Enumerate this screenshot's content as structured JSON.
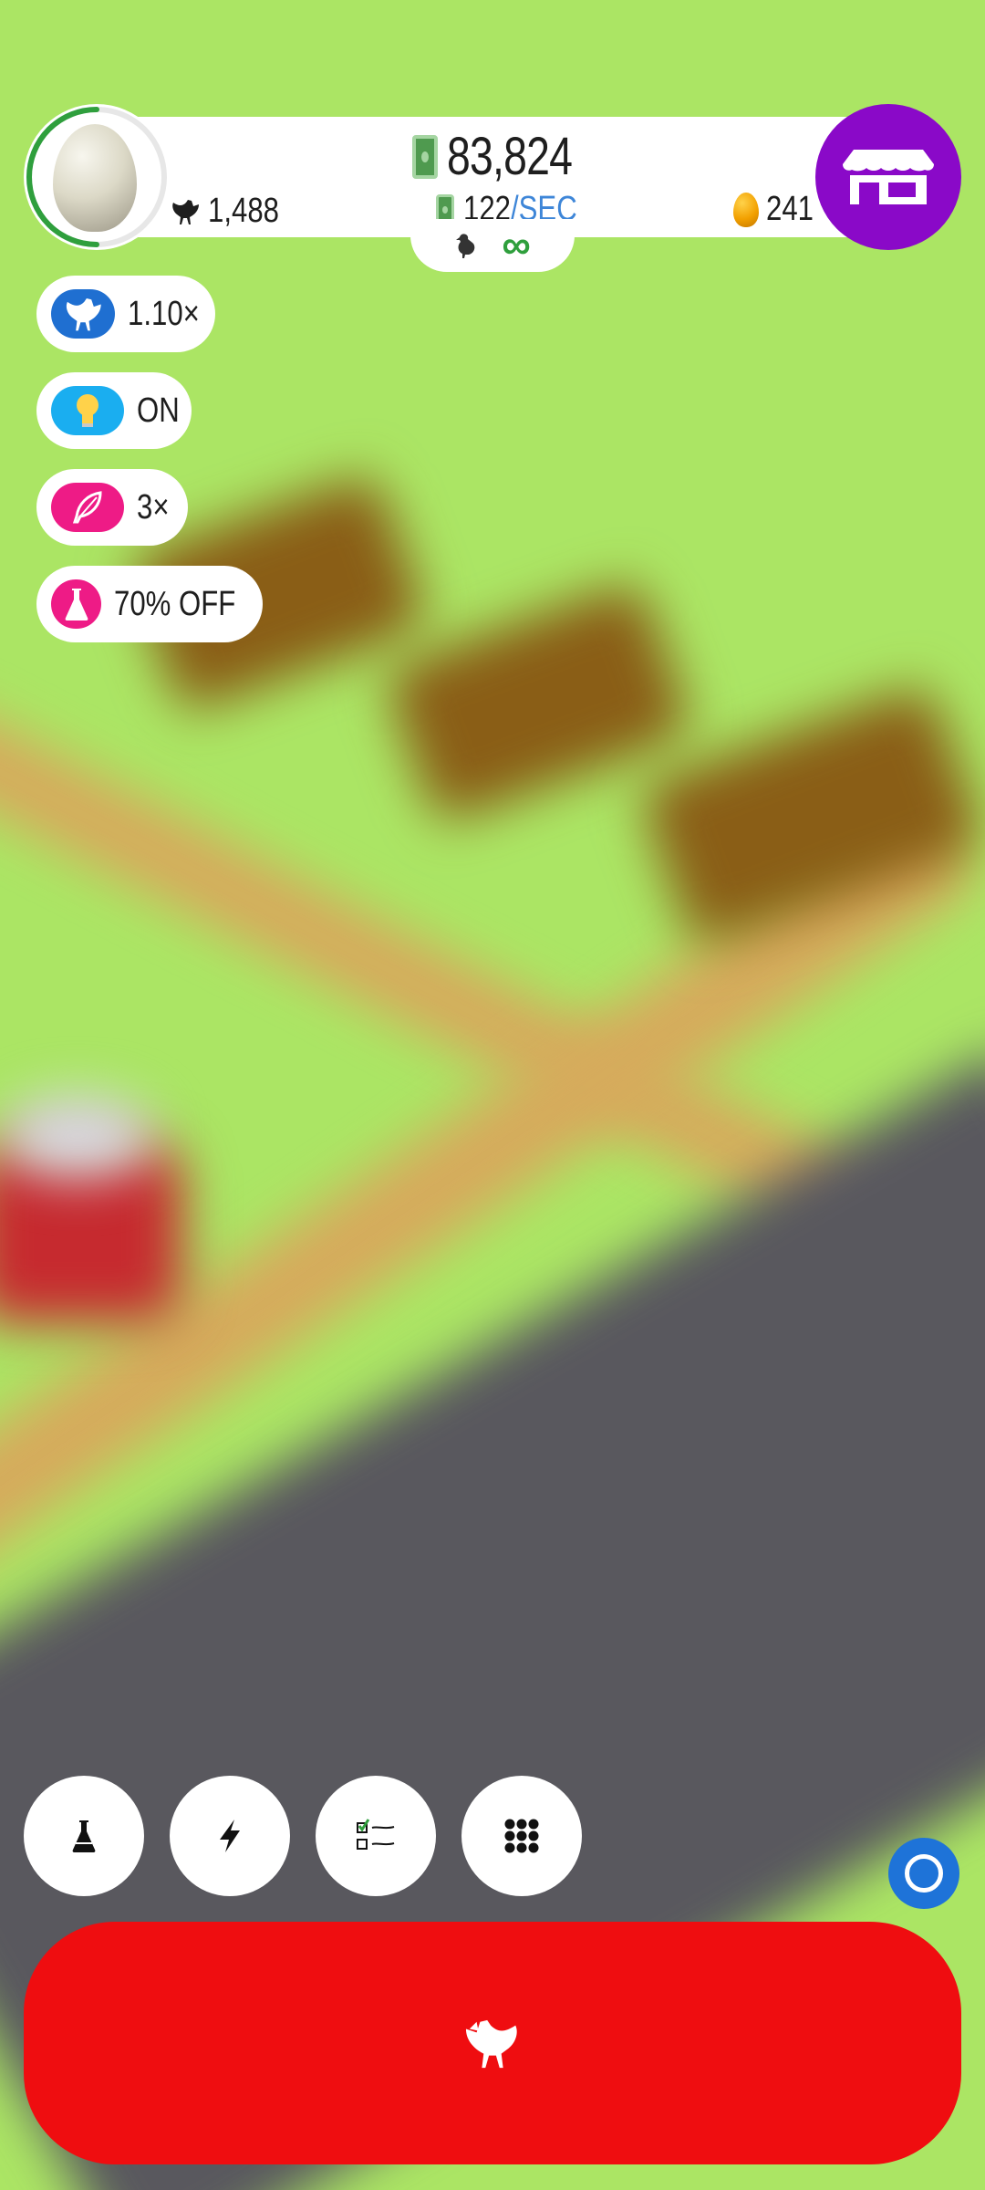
{
  "hud": {
    "money": "83,824",
    "chicken_count": "1,488",
    "rate_value": "122",
    "rate_unit": "/SEC",
    "golden_eggs": "241",
    "habitat_capacity": "∞"
  },
  "boosts": [
    {
      "icon": "chicken-icon",
      "label": "1.10×",
      "color": "#1f6fd1"
    },
    {
      "icon": "lightbulb-icon",
      "label": "ON",
      "color": "#1aaef0"
    },
    {
      "icon": "feather-icon",
      "label": "3×",
      "color": "#ee1b86"
    },
    {
      "icon": "flask-icon",
      "label": "70% OFF",
      "color": "#ee1b86"
    }
  ],
  "toolbar": [
    {
      "icon": "flask-icon",
      "name": "research-button"
    },
    {
      "icon": "lightning-icon",
      "name": "boosts-button"
    },
    {
      "icon": "checklist-icon",
      "name": "missions-button"
    },
    {
      "icon": "grid-menu-icon",
      "name": "menu-button"
    }
  ],
  "colors": {
    "grass": "#abe564",
    "shop": "#8a09c8",
    "hatch_button": "#ef0d10",
    "rate_unit": "#3e86d8"
  }
}
